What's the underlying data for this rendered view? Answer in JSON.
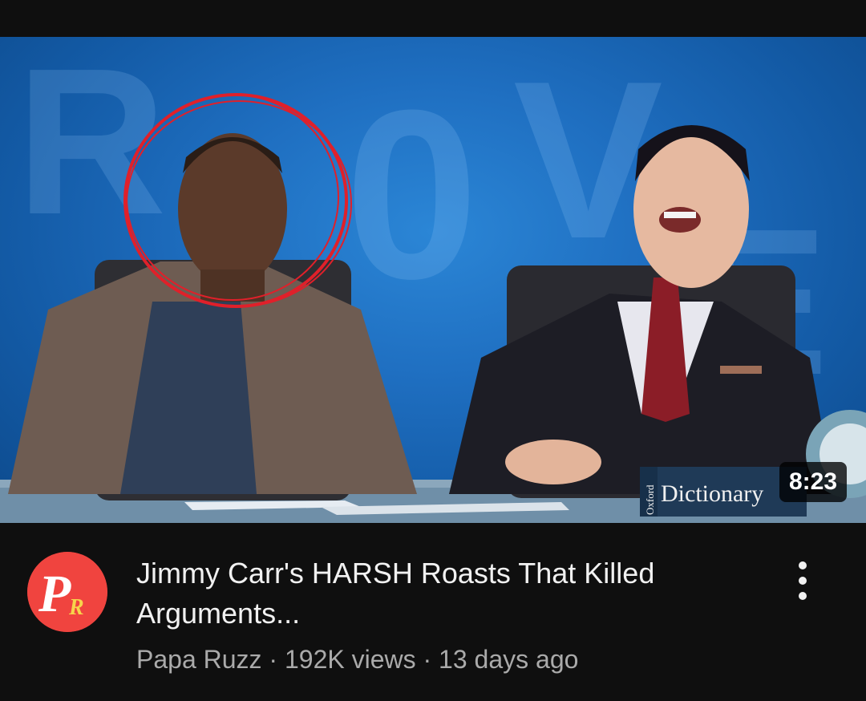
{
  "video": {
    "duration": "8:23",
    "thumbnail_book_text": "Dictionary",
    "thumbnail_book_brand": "Oxford",
    "title": "Jimmy Carr's HARSH Roasts That Killed Arguments...",
    "channel": "Papa Ruzz",
    "views": "192K views",
    "age": "13 days ago",
    "separator": " · "
  },
  "channel_avatar": {
    "letters": "PR",
    "color": "#f0443f"
  },
  "icons": {
    "more": "more-vertical-icon"
  },
  "colors": {
    "background": "#0f0f0f",
    "title": "#f1f1f1",
    "meta": "#aaaaaa",
    "highlight_circle": "#e0202a"
  }
}
